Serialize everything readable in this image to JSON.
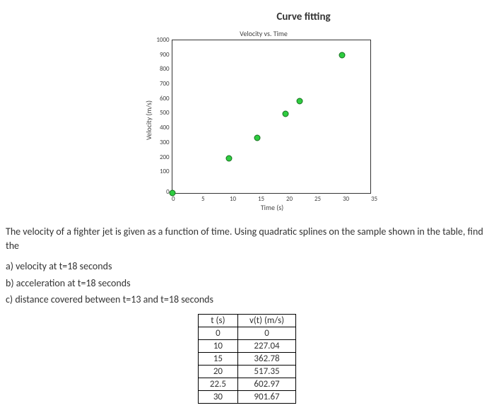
{
  "title": "Curve fitting",
  "chart_data": {
    "type": "scatter",
    "title": "Velocity vs. Time",
    "xlabel": "Time (s)",
    "ylabel": "Velocity (m/s)",
    "xticks": [
      0,
      5,
      10,
      15,
      20,
      25,
      30,
      35
    ],
    "yticks": [
      1000,
      900,
      800,
      700,
      600,
      500,
      400,
      300,
      200,
      100,
      0
    ],
    "xlim": [
      0,
      35
    ],
    "ylim": [
      0,
      1000
    ],
    "x": [
      0,
      10,
      15,
      20,
      22.5,
      30
    ],
    "y": [
      0,
      227.04,
      362.78,
      517.35,
      602.97,
      901.67
    ]
  },
  "problem": {
    "intro": "The velocity of a fighter jet is given as a function of time. Using quadratic splines on the sample shown in the table, find the",
    "a": "a) velocity at t=18 seconds",
    "b": "b) acceleration at t=18 seconds",
    "c": "c) distance covered between t=13 and t=18 seconds"
  },
  "table": {
    "headers": [
      "t (s)",
      "v(t) (m/s)"
    ],
    "rows": [
      [
        "0",
        "0"
      ],
      [
        "10",
        "227.04"
      ],
      [
        "15",
        "362.78"
      ],
      [
        "20",
        "517.35"
      ],
      [
        "22.5",
        "602.97"
      ],
      [
        "30",
        "901.67"
      ]
    ]
  }
}
